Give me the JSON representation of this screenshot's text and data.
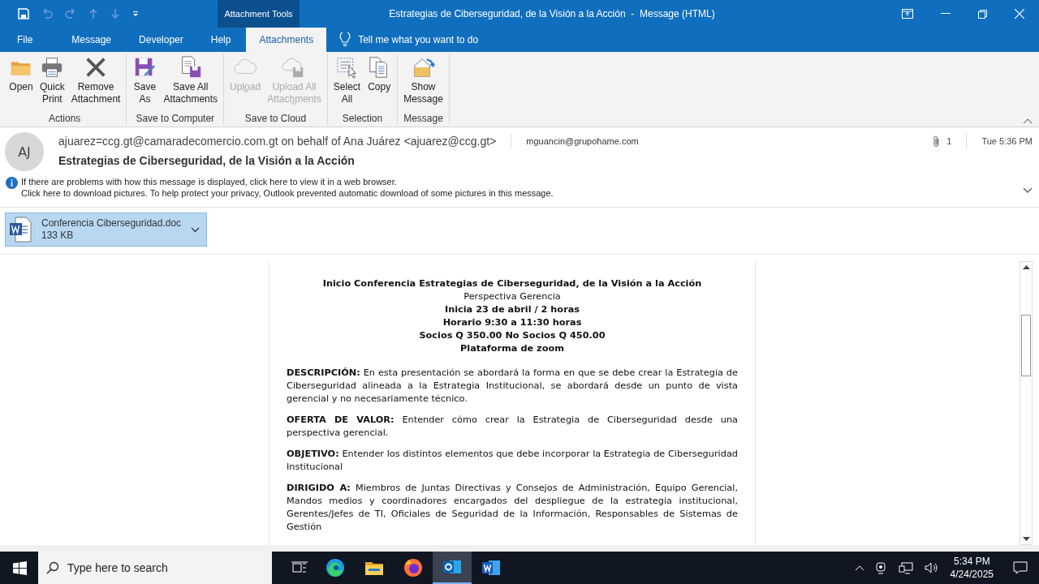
{
  "window": {
    "context_tab": "Attachment Tools",
    "title": "Estrategias de Ciberseguridad, de la Visión a la Acción  -  Message (HTML)"
  },
  "tabs": [
    {
      "label": "File",
      "selected": false
    },
    {
      "label": "Message",
      "selected": false
    },
    {
      "label": "Developer",
      "selected": false
    },
    {
      "label": "Help",
      "selected": false
    },
    {
      "label": "Attachments",
      "selected": true
    }
  ],
  "tell_me": {
    "placeholder": "Tell me what you want to do"
  },
  "ribbon": [
    {
      "name": "Actions",
      "buttons": [
        {
          "kind": "open",
          "label": "Open",
          "disabled": false
        },
        {
          "kind": "print",
          "label": "Quick\nPrint",
          "disabled": false
        },
        {
          "kind": "remove",
          "label": "Remove\nAttachment",
          "disabled": false
        }
      ]
    },
    {
      "name": "Save to Computer",
      "buttons": [
        {
          "kind": "saveas",
          "label": "Save\nAs",
          "disabled": false
        },
        {
          "kind": "saveall",
          "label": "Save All\nAttachments",
          "disabled": false
        }
      ]
    },
    {
      "name": "Save to Cloud",
      "buttons": [
        {
          "kind": "cloud",
          "label": "Upload",
          "disabled": true,
          "dropdown": true
        },
        {
          "kind": "cloudsave",
          "label": "Upload All\nAttachments",
          "disabled": true,
          "dropdown": true
        }
      ]
    },
    {
      "name": "Selection",
      "buttons": [
        {
          "kind": "select",
          "label": "Select\nAll",
          "disabled": false
        },
        {
          "kind": "copy",
          "label": "Copy",
          "disabled": false
        }
      ]
    },
    {
      "name": "Message",
      "buttons": [
        {
          "kind": "show",
          "label": "Show\nMessage",
          "disabled": false
        }
      ]
    }
  ],
  "header": {
    "initials": "AJ",
    "from": "ajuarez=ccg.gt@camaradecomercio.com.gt on behalf of Ana Juárez <ajuarez@ccg.gt>",
    "to": "mguancin@grupohame.com",
    "attachments_count": "1",
    "time": "Tue 5:36 PM",
    "subject": "Estrategias de Ciberseguridad, de la Visión a la Acción",
    "info": [
      "If there are problems with how this message is displayed, click here to view it in a web browser.",
      "Click here to download pictures. To help protect your privacy, Outlook prevented automatic download of some pictures in this message."
    ]
  },
  "attachment": {
    "name": "Conferencia Ciberseguridad.doc",
    "size": "133 KB",
    "selected": true
  },
  "body": {
    "centered": [
      {
        "text": "Inicio Conferencia  Estrategias  de Ciberseguridad,  de la Visión  a la Acción",
        "bold": true
      },
      {
        "text": "Perspectiva Gerencia",
        "bold": false
      },
      {
        "text": "Inicia 23 de abril /  2 horas",
        "bold": true
      },
      {
        "text": "Horario  9:30  a 11:30  horas",
        "bold": true
      },
      {
        "text": "Socios Q 350.00 No Socios Q 450.00",
        "bold": true
      },
      {
        "text": "Plataforma de zoom",
        "bold": true
      }
    ],
    "paragraphs": [
      "**DESCRIPCIÓN:**  En esta presentación se abordará la forma en que se debe crear la Estrategia de Ciberseguridad alineada a la Estrategia Institucional, se abordará desde un punto de vista gerencial y no necesariamente técnico.",
      "**OFERTA  DE  VALOR:** Entender cómo crear la Estrategia de Ciberseguridad desde una perspectiva gerencial.",
      "**OBJETIVO:** Entender los distintos elementos que debe incorporar la Estrategia de Ciberseguridad Institucional",
      "**DIRIGIDO A:** Miembros de Juntas Directivas y Consejos de Administración, Equipo Gerencial, Mandos medios y coordinadores encargados del despliegue de la estrategia institucional, Gerentes/Jefes de TI, Oficiales de Seguridad de la Información, Responsables de Sistemas de Gestión"
    ]
  },
  "taskbar": {
    "search": {
      "placeholder": "Type here to search"
    },
    "apps": [
      {
        "kind": "edge",
        "selected": false
      },
      {
        "kind": "explorer",
        "selected": false
      },
      {
        "kind": "firefox",
        "selected": false
      },
      {
        "kind": "outlook",
        "selected": true
      },
      {
        "kind": "word",
        "selected": false
      }
    ],
    "time": "5:34 PM",
    "date": "4/24/2025"
  }
}
